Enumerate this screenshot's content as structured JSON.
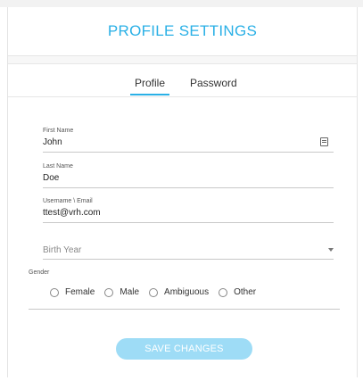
{
  "header": {
    "title": "PROFILE SETTINGS"
  },
  "tabs": [
    {
      "label": "Profile",
      "active": true
    },
    {
      "label": "Password",
      "active": false
    }
  ],
  "fields": {
    "first_name": {
      "label": "First Name",
      "value": "John"
    },
    "last_name": {
      "label": "Last Name",
      "value": "Doe"
    },
    "username_email": {
      "label": "Username \\ Email",
      "value": "ttest@vrh.com"
    },
    "birth_year": {
      "placeholder": "Birth Year"
    }
  },
  "gender": {
    "label": "Gender",
    "options": [
      "Female",
      "Male",
      "Ambiguous",
      "Other"
    ]
  },
  "actions": {
    "save_label": "SAVE CHANGES"
  },
  "colors": {
    "accent": "#2ab0e6",
    "button_bg": "#9edcf6"
  }
}
